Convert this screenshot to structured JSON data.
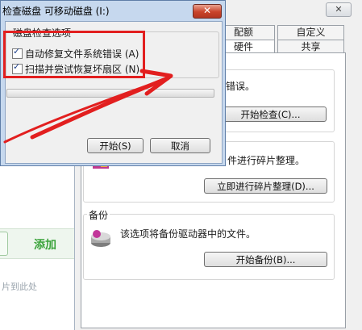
{
  "background": {
    "add_button_label": "添加",
    "hint_text": "片到此处"
  },
  "dialog": {
    "title": "检查磁盘 可移动磁盘 (I:)",
    "close_glyph": "✕",
    "group_title": "磁盘检查选项",
    "options": [
      {
        "label": "自动修复文件系统错误 (A)",
        "checked": true
      },
      {
        "label": "扫描并尝试恢复坏扇区 (N)",
        "checked": true
      }
    ],
    "progress": 0,
    "start_button": "开始(S)",
    "cancel_button": "取消"
  },
  "properties": {
    "close_glyph": "✕",
    "tabs_top": [
      "配额",
      "自定义"
    ],
    "tabs_bottom": [
      "硬件",
      "共享"
    ],
    "error_check_text": "错误。",
    "check_button": "开始检查(C)...",
    "defrag_text": "件进行碎片整理。",
    "defrag_button": "立即进行碎片整理(D)...",
    "backup_title": "备份",
    "backup_text": "该选项将备份驱动器中的文件。",
    "backup_button": "开始备份(B)..."
  },
  "annotation": {
    "highlight_color": "#e21f1f",
    "arrow_color": "#e21f1f"
  }
}
